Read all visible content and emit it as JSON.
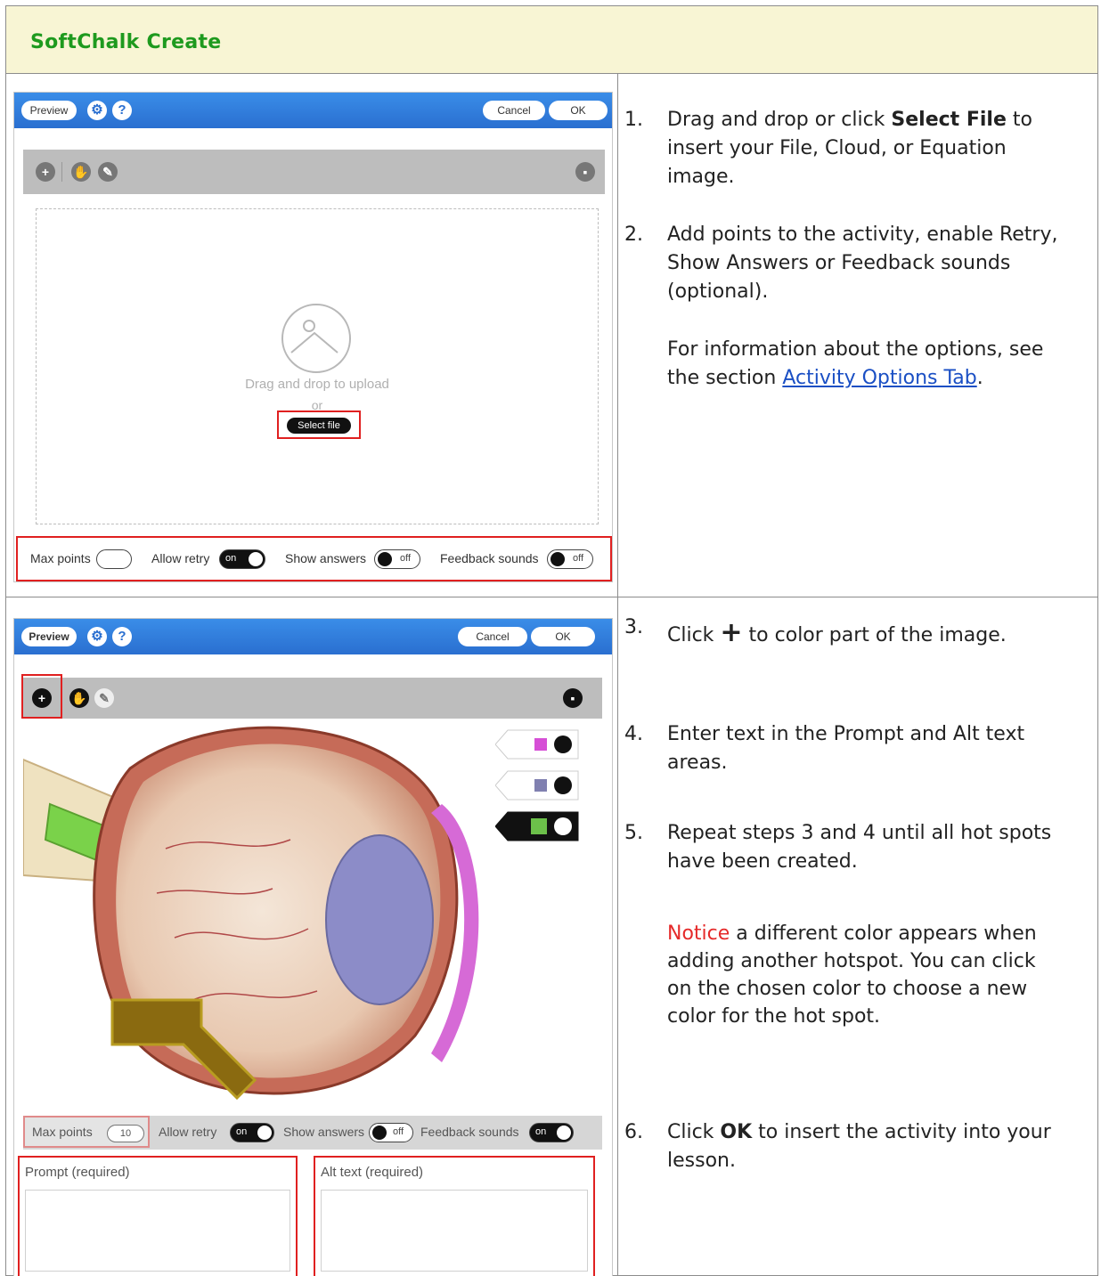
{
  "header": {
    "title": "SoftChalk Create"
  },
  "panel1": {
    "preview_label": "Preview",
    "gear_icon": "gear-icon",
    "help_label": "?",
    "cancel_label": "Cancel",
    "ok_label": "OK",
    "toolbar_icons": [
      "plus-icon",
      "hand-icon",
      "pencil-icon",
      "trash-icon"
    ],
    "drop_text": "Drag and drop to upload",
    "or_text": "or",
    "select_file_label": "Select file",
    "options": {
      "max_points_label": "Max points",
      "allow_retry_label": "Allow retry",
      "allow_retry_state": "on",
      "show_answers_label": "Show answers",
      "show_answers_state": "off",
      "feedback_sounds_label": "Feedback sounds",
      "feedback_sounds_state": "off"
    }
  },
  "panel2": {
    "preview_label": "Preview",
    "help_label": "?",
    "cancel_label": "Cancel",
    "ok_label": "OK",
    "hotspot_colors": [
      "#d64fd6",
      "#8080b0",
      "#6cc04a"
    ],
    "options": {
      "max_points_label": "Max points",
      "max_points_value": "10",
      "allow_retry_label": "Allow retry",
      "allow_retry_state": "on",
      "show_answers_label": "Show answers",
      "show_answers_state": "off",
      "feedback_sounds_label": "Feedback sounds",
      "feedback_sounds_state": "on"
    },
    "prompt_label": "Prompt (required)",
    "alt_text_label": "Alt text (required)"
  },
  "steps_a": {
    "s1_num": "1.",
    "s1_pre": "Drag and drop or click ",
    "s1_bold": "Select File",
    "s1_post": " to insert your File, Cloud, or Equation image.",
    "s2_num": "2.",
    "s2_text": "Add points to the activity, enable Retry, Show Answers or Feedback sounds (optional).",
    "info_pre": "For information about the options, see the section ",
    "info_link": "Activity Options Tab",
    "info_post": "."
  },
  "steps_b": {
    "s3_num": "3.",
    "s3_pre": "Click ",
    "s3_symbol": "+",
    "s3_post": " to color part of the image.",
    "s4_num": "4.",
    "s4_text": "Enter text in the Prompt and Alt text areas.",
    "s5_num": "5.",
    "s5_text": "Repeat steps 3 and 4 until all hot spots have been created.",
    "notice_word": "Notice",
    "notice_rest": " a different color appears when adding another hotspot. You can click on the chosen color to choose a new color for the hot spot.",
    "s6_num": "6.",
    "s6_pre": "Click ",
    "s6_bold": "OK",
    "s6_post": " to insert the activity into your lesson."
  },
  "colors": {
    "header_bg": "#f8f5d4",
    "header_text": "#1e9a1e",
    "link": "#1a4fc4",
    "notice": "#e52a2a",
    "highlight": "#e02020"
  }
}
